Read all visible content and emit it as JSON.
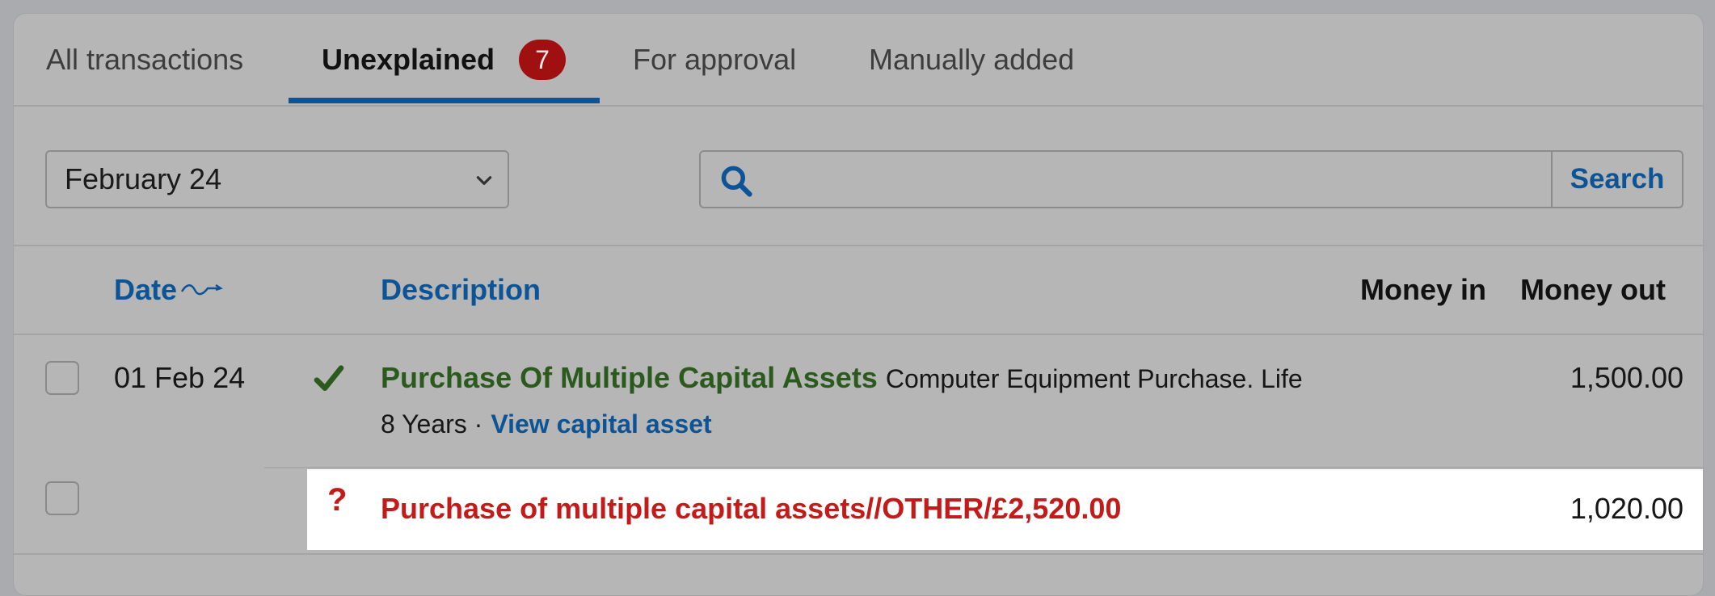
{
  "tabs": [
    {
      "label": "All transactions"
    },
    {
      "label": "Unexplained",
      "badge": "7"
    },
    {
      "label": "For approval"
    },
    {
      "label": "Manually added"
    }
  ],
  "filters": {
    "period": "February 24",
    "search_placeholder": "",
    "search_button": "Search"
  },
  "table": {
    "headers": {
      "date": "Date",
      "description": "Description",
      "money_in": "Money in",
      "money_out": "Money out"
    },
    "rows": [
      {
        "date": "01 Feb 24",
        "status_icon": "check-icon",
        "title": "Purchase Of Multiple Capital Assets",
        "detail_line1": "Computer Equipment Purchase. Life",
        "detail_line2": "8 Years ·",
        "link": "View capital asset",
        "money_in": "",
        "money_out": "1,500.00"
      },
      {
        "date": "",
        "status_icon": "question-icon",
        "title": "Purchase of multiple capital assets//OTHER/£2,520.00",
        "money_in": "",
        "money_out": "1,020.00"
      }
    ]
  },
  "colors": {
    "accent_blue": "#0c5496",
    "badge_red": "#a01010",
    "explained_green": "#2a5a1c",
    "unexplained_red": "#c31a1a"
  }
}
